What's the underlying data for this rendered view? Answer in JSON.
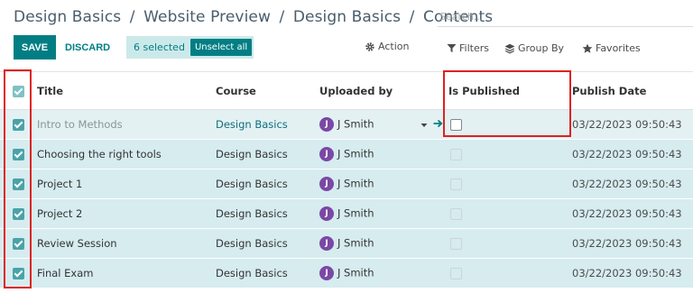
{
  "breadcrumb": {
    "items": [
      "Design Basics",
      "Website Preview",
      "Design Basics",
      "Contents"
    ],
    "separator": "/"
  },
  "search": {
    "placeholder": "Search..."
  },
  "toolbar": {
    "save_label": "SAVE",
    "discard_label": "DISCARD",
    "selected_text": "6 selected",
    "unselect_label": "Unselect all",
    "action_label": "Action",
    "filters_label": "Filters",
    "groupby_label": "Group By",
    "favorites_label": "Favorites"
  },
  "table": {
    "columns": {
      "title": "Title",
      "course": "Course",
      "uploaded_by": "Uploaded by",
      "is_published": "Is Published",
      "publish_date": "Publish Date"
    },
    "rows": [
      {
        "title": "Intro to Methods",
        "course": "Design Basics",
        "avatar": "J",
        "uploaded_by": "J Smith",
        "is_published": false,
        "publish_date": "03/22/2023 09:50:43",
        "selected": true,
        "editing": true
      },
      {
        "title": "Choosing the right tools",
        "course": "Design Basics",
        "avatar": "J",
        "uploaded_by": "J Smith",
        "is_published": false,
        "publish_date": "03/22/2023 09:50:43",
        "selected": true,
        "editing": false
      },
      {
        "title": "Project 1",
        "course": "Design Basics",
        "avatar": "J",
        "uploaded_by": "J Smith",
        "is_published": false,
        "publish_date": "03/22/2023 09:50:43",
        "selected": true,
        "editing": false
      },
      {
        "title": "Project 2",
        "course": "Design Basics",
        "avatar": "J",
        "uploaded_by": "J Smith",
        "is_published": false,
        "publish_date": "03/22/2023 09:50:43",
        "selected": true,
        "editing": false
      },
      {
        "title": "Review Session",
        "course": "Design Basics",
        "avatar": "J",
        "uploaded_by": "J Smith",
        "is_published": false,
        "publish_date": "03/22/2023 09:50:43",
        "selected": true,
        "editing": false
      },
      {
        "title": "Final Exam",
        "course": "Design Basics",
        "avatar": "J",
        "uploaded_by": "J Smith",
        "is_published": false,
        "publish_date": "03/22/2023 09:50:43",
        "selected": true,
        "editing": false
      }
    ]
  },
  "colors": {
    "primary": "#017e84",
    "selected_row": "#d6ecef",
    "avatar": "#7b48a5",
    "highlight": "#e02020"
  },
  "icons": {
    "action": "gear-icon",
    "filters": "filter-icon",
    "groupby": "layers-icon",
    "favorites": "star-icon",
    "dropdown": "caret-down-icon",
    "open_record": "arrow-right-icon"
  }
}
